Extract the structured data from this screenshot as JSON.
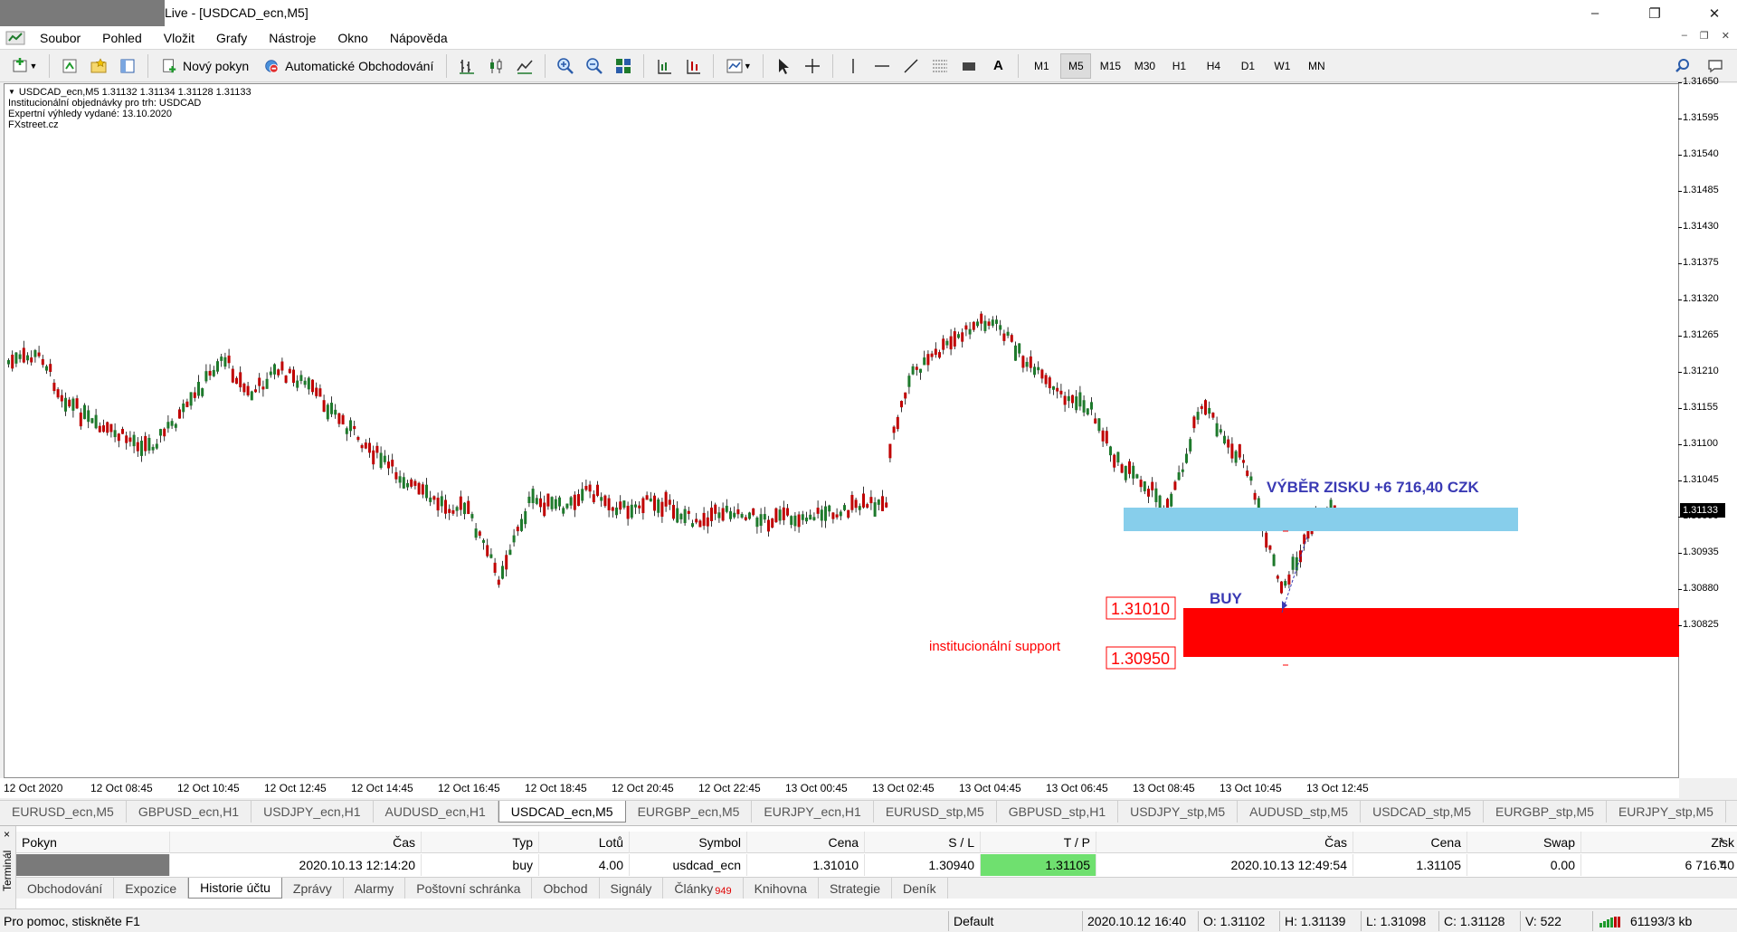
{
  "window": {
    "title": "Live - [USDCAD_ecn,M5]",
    "controls": [
      "–",
      "❐",
      "✕"
    ]
  },
  "menu": [
    "Soubor",
    "Pohled",
    "Vložit",
    "Grafy",
    "Nástroje",
    "Okno",
    "Nápověda"
  ],
  "toolbar": {
    "new_order": "Nový pokyn",
    "auto_trading": "Automatické Obchodování",
    "timeframes": [
      "M1",
      "M5",
      "M15",
      "M30",
      "H1",
      "H4",
      "D1",
      "W1",
      "MN"
    ],
    "active_timeframe": "M5",
    "text_tool": "A"
  },
  "chart": {
    "info_lines": [
      "USDCAD_ecn,M5  1.31132 1.31134 1.31128 1.31133",
      "Institucionální objednávky pro trh: USDCAD",
      "Expertní výhledy vydané: 13.10.2020",
      "FXstreet.cz"
    ],
    "price_ticks": [
      "1.31650",
      "1.31595",
      "1.31540",
      "1.31485",
      "1.31430",
      "1.31375",
      "1.31320",
      "1.31265",
      "1.31210",
      "1.31155",
      "1.31100",
      "1.31045",
      "1.30990",
      "1.30935",
      "1.30880",
      "1.30825"
    ],
    "current_price": "1.31133",
    "time_ticks": [
      "12 Oct 2020",
      "12 Oct 08:45",
      "12 Oct 10:45",
      "12 Oct 12:45",
      "12 Oct 14:45",
      "12 Oct 16:45",
      "12 Oct 18:45",
      "12 Oct 20:45",
      "12 Oct 22:45",
      "13 Oct 00:45",
      "13 Oct 02:45",
      "13 Oct 04:45",
      "13 Oct 06:45",
      "13 Oct 08:45",
      "13 Oct 10:45",
      "13 Oct 12:45"
    ],
    "profit_label": "VÝBĚR ZISKU +6 716,40 CZK",
    "buy_label": "BUY",
    "support_label": "institucionální support",
    "support_high": "1.31010",
    "support_low": "1.30950",
    "colors": {
      "up": "#1e7a2c",
      "down": "#c00000",
      "support_zone": "#ff0000",
      "profit_zone": "#87ceeb",
      "annotation": "#3a3ab4"
    }
  },
  "chart_tabs": [
    "EURUSD_ecn,M5",
    "GBPUSD_ecn,H1",
    "USDJPY_ecn,H1",
    "AUDUSD_ecn,H1",
    "USDCAD_ecn,M5",
    "EURGBP_ecn,M5",
    "EURJPY_ecn,H1",
    "EURUSD_stp,M5",
    "GBPUSD_stp,H1",
    "USDJPY_stp,M5",
    "AUDUSD_stp,M5",
    "USDCAD_stp,M5",
    "EURGBP_stp,M5",
    "EURJPY_stp,M5"
  ],
  "active_chart_tab": "USDCAD_ecn,M5",
  "terminal": {
    "side_label": "Terminál",
    "close": "×",
    "headers": [
      "Pokyn",
      "Čas",
      "Typ",
      "Lotů",
      "Symbol",
      "Cena",
      "S / L",
      "T / P",
      "Čas",
      "Cena",
      "Swap",
      "Zisk"
    ],
    "row": [
      "",
      "2020.10.13 12:14:20",
      "buy",
      "4.00",
      "usdcad_ecn",
      "1.31010",
      "1.30940",
      "1.31105",
      "2020.10.13 12:49:54",
      "1.31105",
      "0.00",
      "6 716.40"
    ],
    "tabs": [
      "Obchodování",
      "Expozice",
      "Historie účtu",
      "Zprávy",
      "Alarmy",
      "Poštovní schránka",
      "Obchod",
      "Signály",
      "Články",
      "Knihovna",
      "Strategie",
      "Deník"
    ],
    "active_tab": "Historie účtu",
    "articles_badge": "949"
  },
  "status": {
    "help": "Pro pomoc, stiskněte F1",
    "profile": "Default",
    "datetime": "2020.10.12 16:40",
    "open": "O: 1.31102",
    "high": "H: 1.31139",
    "low": "L: 1.31098",
    "close": "C: 1.31128",
    "volume": "V: 522",
    "traffic": "61193/3 kb"
  }
}
